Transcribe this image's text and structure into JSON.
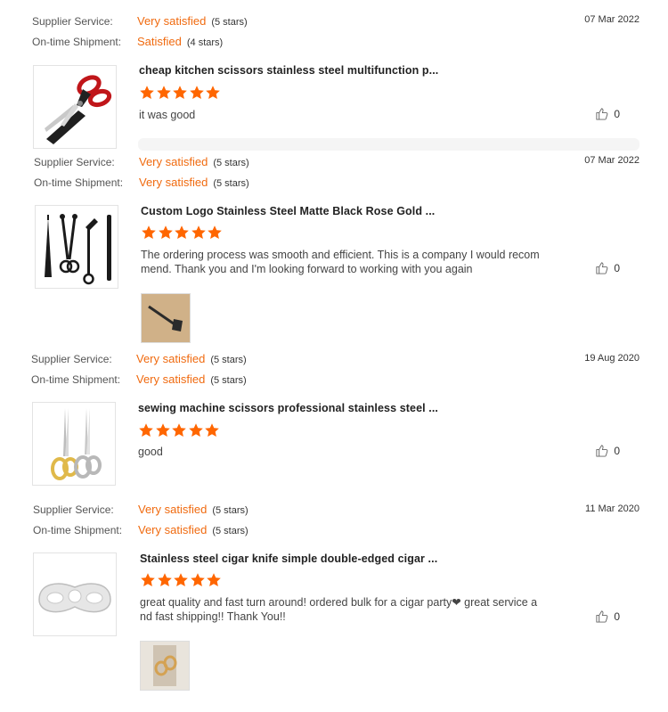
{
  "labels": {
    "supplier_service": "Supplier Service:",
    "ontime_shipment": "On-time Shipment:"
  },
  "reviews": [
    {
      "date": "07 Mar 2022",
      "supplier_value": "Very satisfied",
      "supplier_stars": "(5 stars)",
      "shipment_value": "Satisfied",
      "shipment_stars": "(4 stars)",
      "product_title": "cheap kitchen scissors stainless steel multifunction p...",
      "rating": 5,
      "text": "it was good",
      "likes": "0",
      "product_image": "kitchen-scissors"
    },
    {
      "date": "07 Mar 2022",
      "supplier_value": "Very satisfied",
      "supplier_stars": "(5 stars)",
      "shipment_value": "Very satisfied",
      "shipment_stars": "(5 stars)",
      "product_title": "Custom Logo Stainless Steel Matte Black Rose Gold ...",
      "rating": 5,
      "text_line1": "The ordering process was smooth and efficient. This is a company I would recom",
      "text_line2": "mend. Thank you and I'm looking forward to working with you again",
      "likes": "0",
      "product_image": "candle-tools",
      "photo": "snuffer-photo"
    },
    {
      "date": "19 Aug 2020",
      "supplier_value": "Very satisfied",
      "supplier_stars": "(5 stars)",
      "shipment_value": "Very satisfied",
      "shipment_stars": "(5 stars)",
      "product_title": "sewing machine scissors professional stainless steel ...",
      "rating": 5,
      "text": "good",
      "likes": "0",
      "product_image": "sewing-scissors"
    },
    {
      "date": "11 Mar 2020",
      "supplier_value": "Very satisfied",
      "supplier_stars": "(5 stars)",
      "shipment_value": "Very satisfied",
      "shipment_stars": "(5 stars)",
      "product_title": "Stainless steel cigar knife simple double-edged cigar ...",
      "rating": 5,
      "text_line1": "great quality and fast turn around! ordered bulk for a cigar party❤ great service a",
      "text_line2": "nd fast shipping!! Thank You!!",
      "likes": "0",
      "product_image": "cigar-cutter",
      "photo": "cigar-cutter-photo"
    }
  ],
  "colors": {
    "accent": "#f06a0f",
    "star": "#ff6600"
  }
}
